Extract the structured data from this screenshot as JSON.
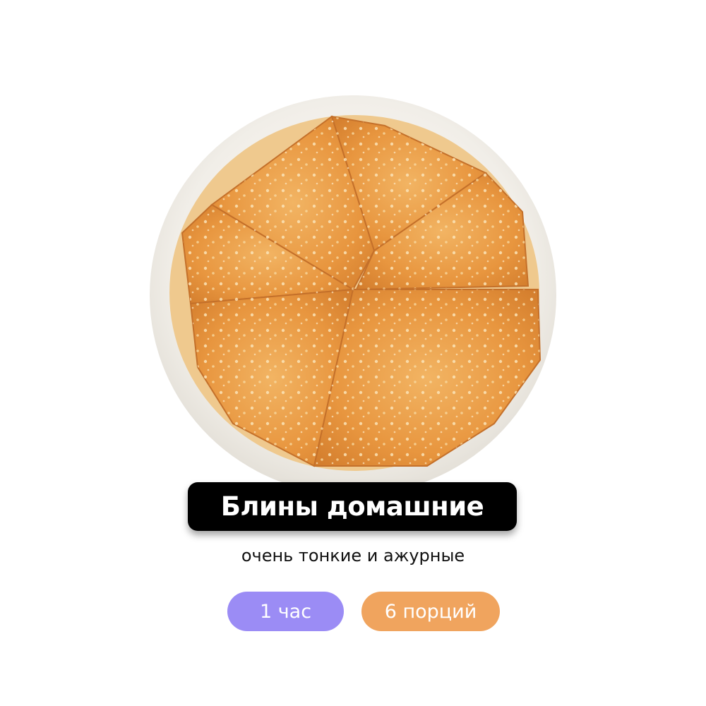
{
  "recipe": {
    "title": "Блины домашние",
    "subtitle": "очень тонкие и ажурные",
    "time_tag": "1 час",
    "servings_tag": "6 порций"
  },
  "colors": {
    "title_bg": "#000000",
    "title_text": "#ffffff",
    "time_tag_bg": "#9b8cf5",
    "servings_tag_bg": "#f0a45e",
    "plate": "#f2efe9",
    "pancake": "#e8963f"
  },
  "icons": {
    "dish_image": "plate-of-folded-pancakes"
  }
}
